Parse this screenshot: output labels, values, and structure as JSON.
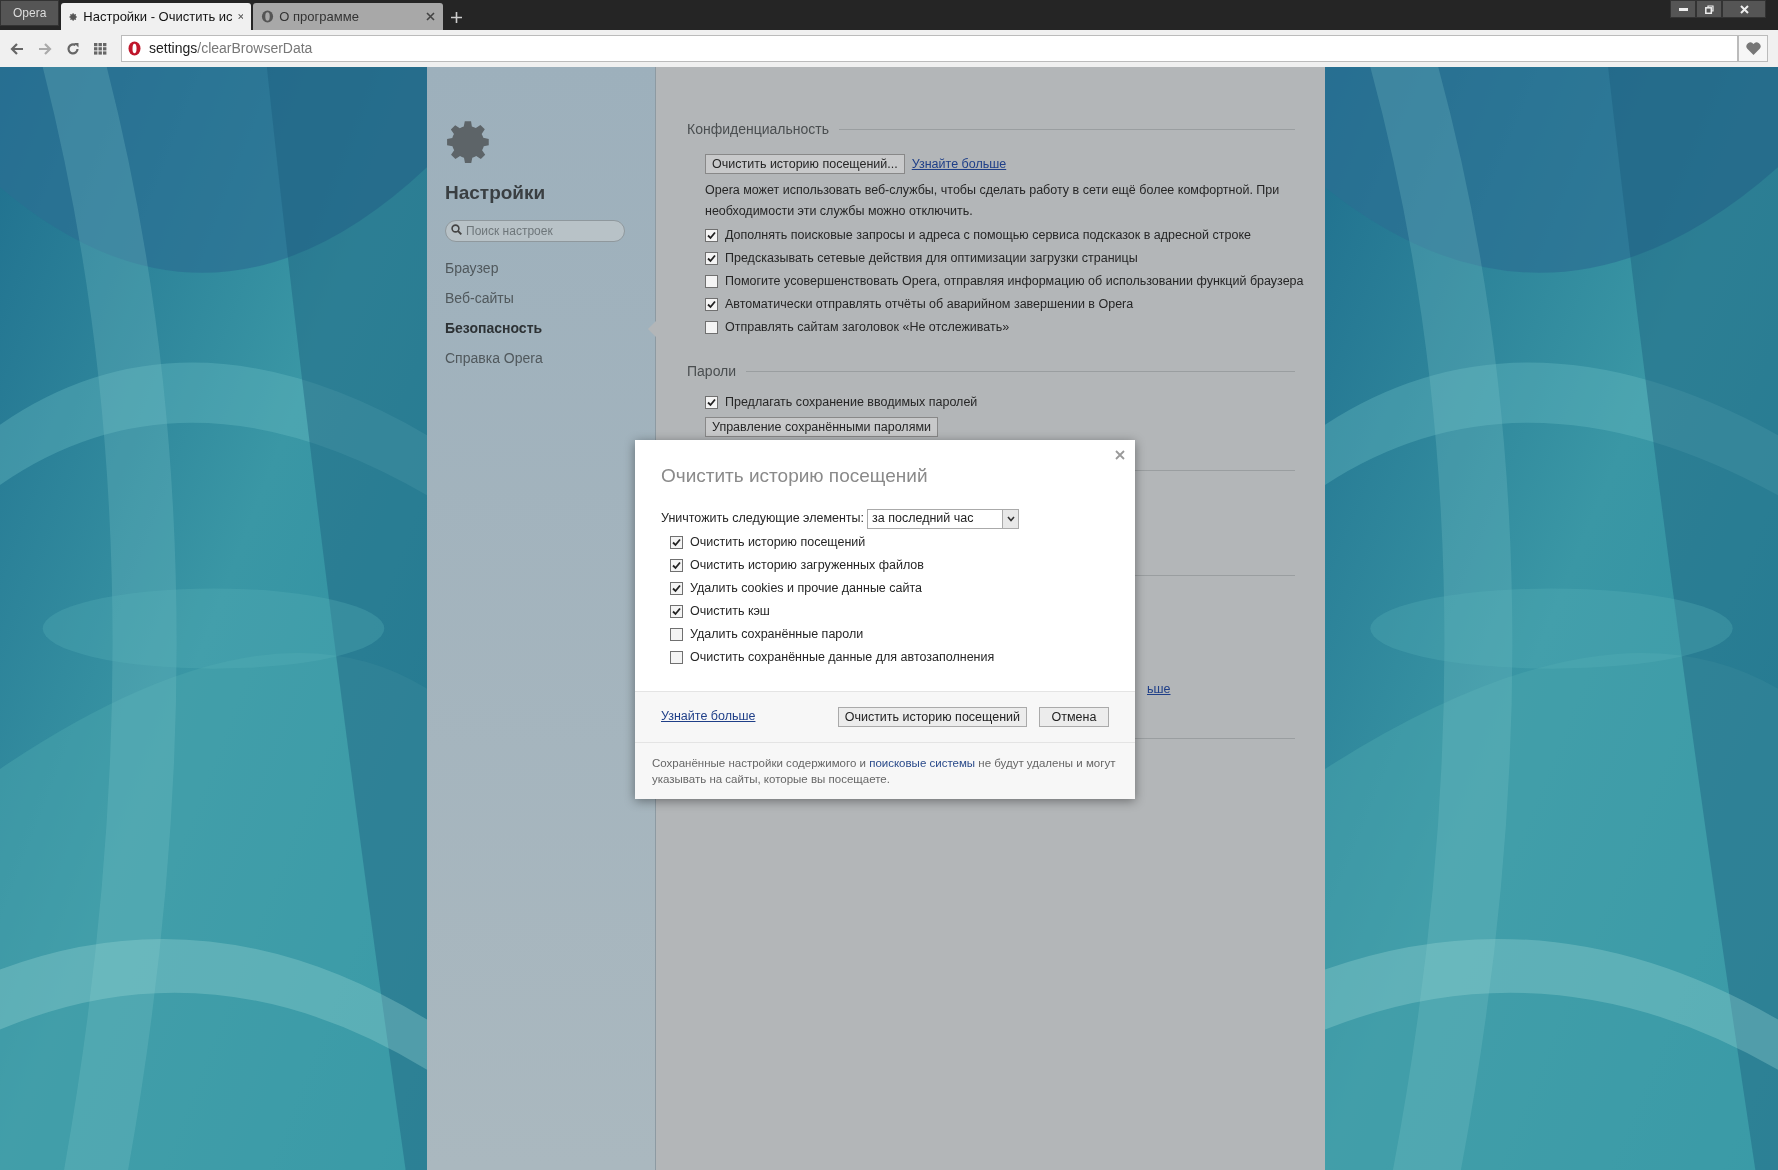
{
  "menu_button": {
    "label": "Opera"
  },
  "tabs": [
    {
      "label": "Настройки - Очистить ис",
      "kind": "settings",
      "selected": true
    },
    {
      "label": "О программе",
      "kind": "opera",
      "selected": false
    }
  ],
  "address_bar": {
    "host": "settings",
    "path": "/clearBrowserData"
  },
  "sidebar": {
    "title": "Настройки",
    "search": {
      "placeholder": "Поиск настроек"
    },
    "items": [
      {
        "label": "Браузер",
        "selected": false
      },
      {
        "label": "Веб-сайты",
        "selected": false
      },
      {
        "label": "Безопасность",
        "selected": true
      },
      {
        "label": "Справка Opera",
        "selected": false
      }
    ]
  },
  "privacy": {
    "heading": "Конфиденциальность",
    "button": "Очистить историю посещений...",
    "link": "Узнайте больше",
    "description": "Opera может использовать веб-службы, чтобы сделать работу в сети ещё более комфортной. При необходимости эти службы можно отключить.",
    "options": [
      {
        "label": "Дополнять поисковые запросы и адреса с помощью сервиса подсказок в адресной строке",
        "checked": true
      },
      {
        "label": "Предсказывать сетевые действия для оптимизации загрузки страницы",
        "checked": true
      },
      {
        "label": "Помогите усовершенствовать Opera, отправляя информацию об использовании функций браузера",
        "checked": false
      },
      {
        "label": "Автоматически отправлять отчёты об аварийном завершении в Opera",
        "checked": true
      },
      {
        "label": "Отправлять сайтам заголовок «Не отслеживать»",
        "checked": false
      }
    ]
  },
  "passwords": {
    "heading": "Пароли",
    "options": [
      {
        "label": "Предлагать сохранение вводимых паролей",
        "checked": true
      }
    ],
    "button": "Управление сохранёнными паролями"
  },
  "obscured_link": "ьше",
  "dialog": {
    "title": "Очистить историю посещений",
    "period_label": "Уничтожить следующие элементы:",
    "period": "за последний час",
    "options": [
      {
        "label": "Очистить историю посещений",
        "checked": true
      },
      {
        "label": "Очистить историю загруженных файлов",
        "checked": true
      },
      {
        "label": "Удалить cookies и прочие данные сайта",
        "checked": true
      },
      {
        "label": "Очистить кэш",
        "checked": true
      },
      {
        "label": "Удалить сохранённые пароли",
        "checked": false
      },
      {
        "label": "Очистить сохранённые данные для автозаполнения",
        "checked": false
      }
    ],
    "link": "Узнайте больше",
    "confirm": "Очистить историю посещений",
    "cancel": "Отмена",
    "note": "Сохранённые настройки содержимого и **поисковые системы** не будут удалены и могут указывать на сайты, которые вы посещаете."
  }
}
